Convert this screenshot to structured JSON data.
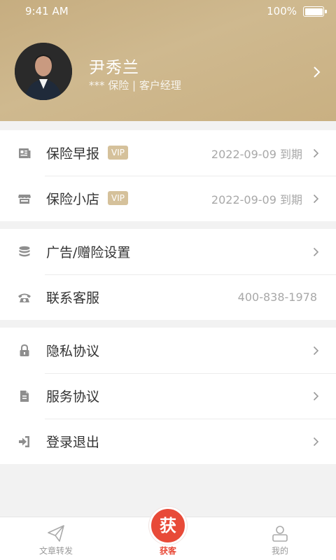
{
  "status_bar": {
    "time": "9:41 AM",
    "battery": "100%"
  },
  "profile": {
    "name": "尹秀兰",
    "subtitle": "*** 保险 | 客户经理"
  },
  "groups": [
    {
      "items": [
        {
          "icon": "newspaper-icon",
          "label": "保险早报",
          "vip": "VIP",
          "value": "2022-09-09  到期"
        },
        {
          "icon": "shop-icon",
          "label": "保险小店",
          "vip": "VIP",
          "value": "2022-09-09  到期"
        }
      ]
    },
    {
      "items": [
        {
          "icon": "database-icon",
          "label": "广告/赠险设置"
        },
        {
          "icon": "telephone-icon",
          "label": "联系客服",
          "value": "400-838-1978"
        }
      ]
    },
    {
      "items": [
        {
          "icon": "lock-icon",
          "label": "隐私协议"
        },
        {
          "icon": "document-icon",
          "label": "服务协议"
        },
        {
          "icon": "logout-icon",
          "label": "登录退出"
        }
      ]
    }
  ],
  "tabbar": {
    "tabs": [
      {
        "icon": "paper-plane-icon",
        "label": "文章转发"
      },
      {
        "icon": "huoke-logo-icon",
        "label": "获客",
        "glyph": "获"
      },
      {
        "icon": "user-profile-icon",
        "label": "我的"
      }
    ]
  },
  "colors": {
    "header_gold": "#c9b185",
    "accent_red": "#e84a38",
    "vip_gold": "#d5c19b"
  }
}
